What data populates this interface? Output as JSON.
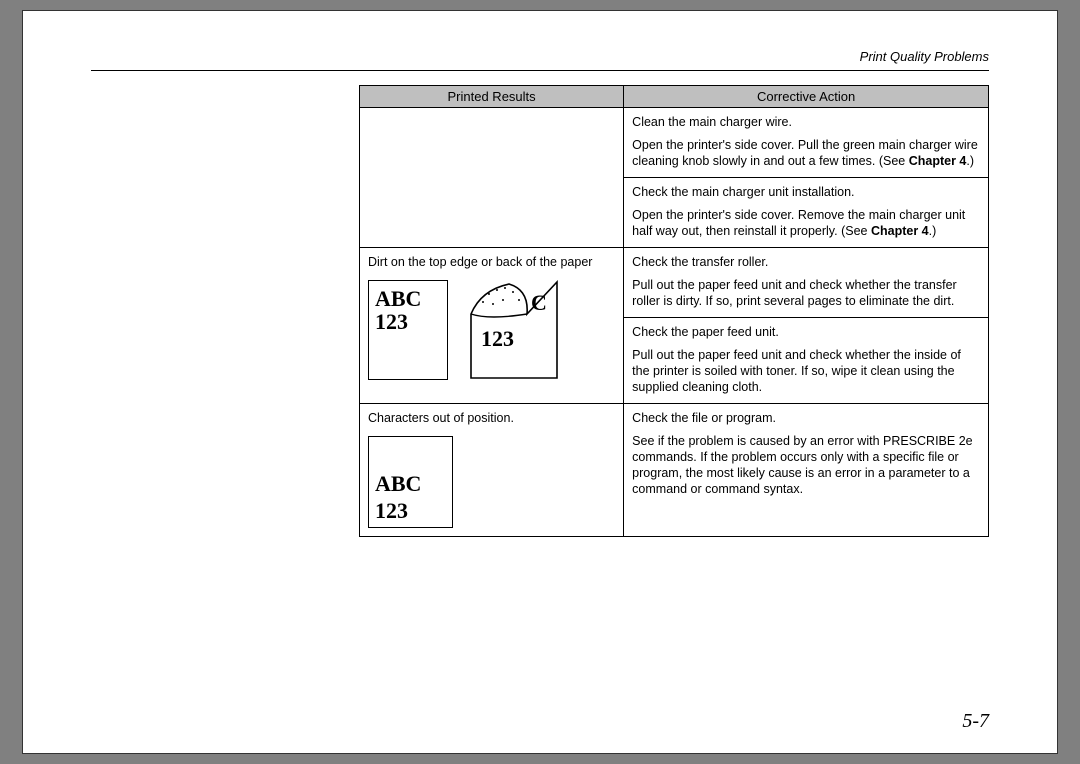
{
  "header": {
    "title": "Print Quality Problems"
  },
  "table": {
    "headers": {
      "results": "Printed Results",
      "action": "Corrective Action"
    },
    "rows": {
      "r1_action_head": "Clean the main charger wire.",
      "r1_action_body_a": "Open the printer's side cover. Pull the green main charger wire cleaning knob slowly in and out a few times. (See ",
      "r1_action_body_bold": "Chapter 4",
      "r1_action_body_b": ".)",
      "r2_action_head": "Check the main charger unit installation.",
      "r2_action_body_a": "Open the printer's side cover. Remove the main charger unit half way out, then reinstall it properly. (See ",
      "r2_action_body_bold": "Chapter 4",
      "r2_action_body_b": ".)",
      "r3_result": "Dirt on the top edge or back of the paper",
      "r3a_head": "Check the transfer roller.",
      "r3a_body": "Pull out the paper feed unit and check whether the transfer roller is dirty.  If so, print several pages to eliminate the dirt.",
      "r3b_head": "Check the paper feed unit.",
      "r3b_body": "Pull out the paper feed unit and check whether the inside of the printer is soiled with toner.  If so, wipe it clean using the supplied cleaning cloth.",
      "r4_result": "Characters out of position.",
      "r4_head": "Check the file or program.",
      "r4_body": "See if the problem is caused by an error with PRESCRIBE 2e commands. If the problem occurs only with a specific file or program, the most likely cause is an error in a parameter to a command or command syntax."
    },
    "illus_text": {
      "abc": "ABC",
      "num": "123"
    }
  },
  "page_number": "5-7"
}
